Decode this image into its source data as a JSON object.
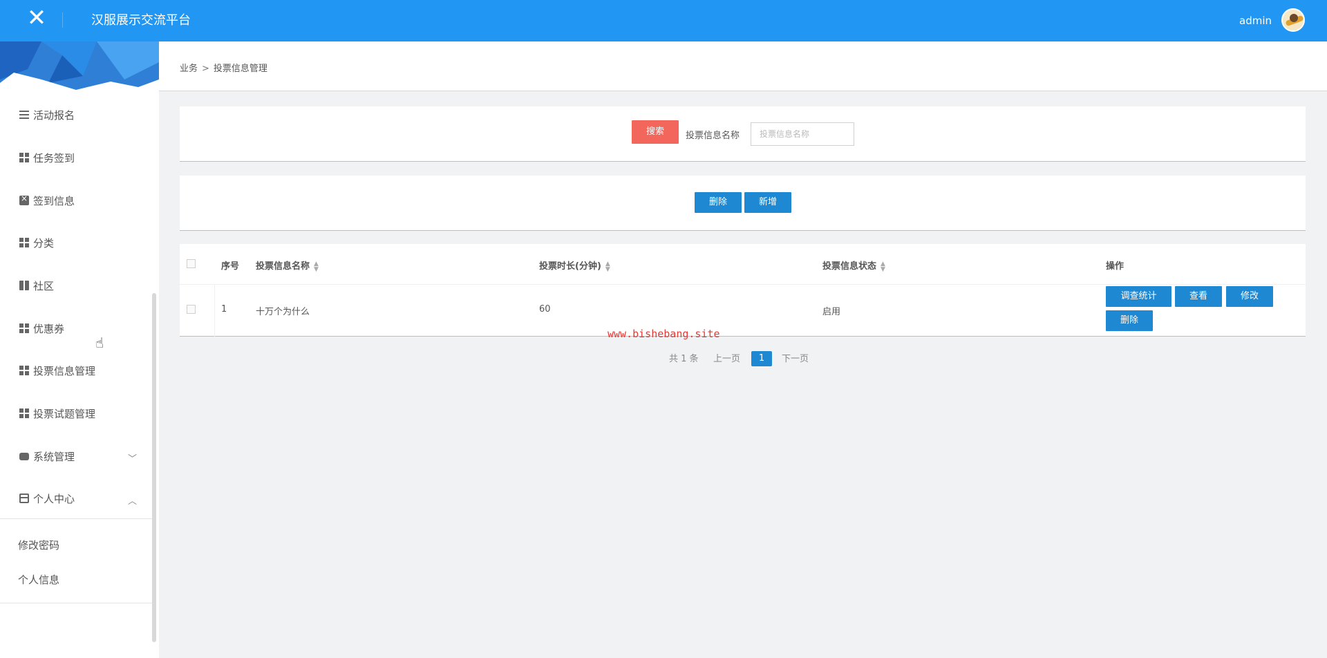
{
  "app": {
    "title": "汉服展示交流平台",
    "close_icon": "close-icon",
    "user": "admin",
    "accent": "#2196f3"
  },
  "sidebar": {
    "items": [
      {
        "label": "活动报名",
        "icon": "sliders-icon"
      },
      {
        "label": "任务签到",
        "icon": "grid-icon"
      },
      {
        "label": "签到信息",
        "icon": "clipboard-icon"
      },
      {
        "label": "分类",
        "icon": "grid-icon"
      },
      {
        "label": "社区",
        "icon": "book-icon"
      },
      {
        "label": "优惠券",
        "icon": "grid-icon"
      },
      {
        "label": "投票信息管理",
        "icon": "grid-icon"
      },
      {
        "label": "投票试题管理",
        "icon": "grid-icon"
      },
      {
        "label": "系统管理",
        "icon": "drive-icon"
      },
      {
        "label": "个人中心",
        "icon": "card-icon"
      }
    ],
    "submenu": [
      {
        "label": "修改密码"
      },
      {
        "label": "个人信息"
      }
    ]
  },
  "breadcrumb": {
    "root": "业务",
    "separator": ">",
    "current": "投票信息管理"
  },
  "search": {
    "button": "搜索",
    "label": "投票信息名称",
    "placeholder": "投票信息名称"
  },
  "actions": {
    "delete": "删除",
    "add": "新增"
  },
  "table": {
    "headers": {
      "index": "序号",
      "name": "投票信息名称",
      "duration": "投票时长(分钟)",
      "status": "投票信息状态",
      "ops": "操作"
    },
    "rows": [
      {
        "index": "1",
        "name": "十万个为什么",
        "duration": "60",
        "status": "启用",
        "buttons": {
          "stats": "调查统计",
          "view": "查看",
          "edit": "修改",
          "delete": "删除"
        }
      }
    ]
  },
  "watermark": "www.bishebang.site",
  "pagination": {
    "total": "共 1 条",
    "prev": "上一页",
    "current": "1",
    "next": "下一页"
  },
  "colors": {
    "danger": "#f3665b",
    "primary_button": "#1e88d2"
  }
}
